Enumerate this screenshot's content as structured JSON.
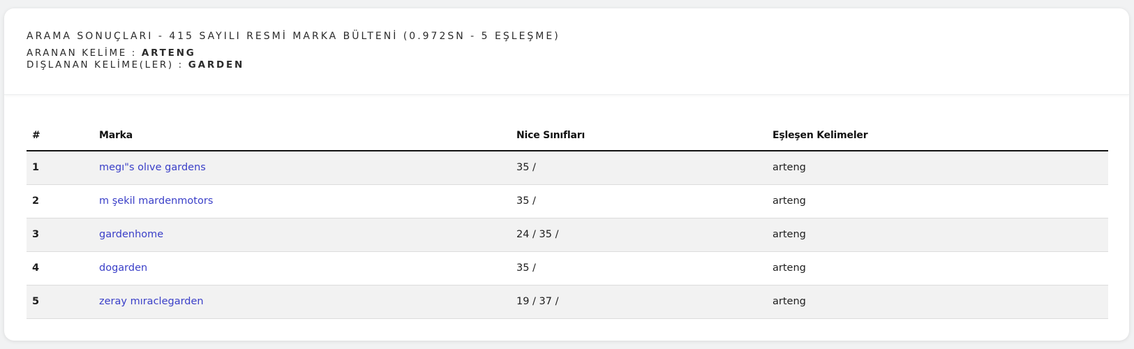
{
  "header": {
    "title": "ARAMA SONUÇLARI - 415 SAYILI RESMİ MARKA BÜLTENİ (0.972SN - 5 EŞLEŞME)",
    "searched_label": "ARANAN KELİME : ",
    "searched_value": "ARTENG",
    "excluded_label": "DIŞLANAN KELİME(LER) : ",
    "excluded_value": "GARDEN"
  },
  "table": {
    "columns": [
      "#",
      "Marka",
      "Nice Sınıfları",
      "Eşleşen Kelimeler"
    ],
    "rows": [
      {
        "num": "1",
        "brand": "megı\"s olıve gardens",
        "nice": "35 /",
        "matched": "arteng"
      },
      {
        "num": "2",
        "brand": "m şekil mardenmotors",
        "nice": "35 /",
        "matched": "arteng"
      },
      {
        "num": "3",
        "brand": "gardenhome",
        "nice": "24 / 35 /",
        "matched": "arteng"
      },
      {
        "num": "4",
        "brand": "dogarden",
        "nice": "35 /",
        "matched": "arteng"
      },
      {
        "num": "5",
        "brand": "zeray mıraclegarden",
        "nice": "19 / 37 /",
        "matched": "arteng"
      }
    ]
  },
  "colors": {
    "link": "#3a3fc8",
    "stripe": "#f2f2f2",
    "background": "#f1f2f3"
  }
}
